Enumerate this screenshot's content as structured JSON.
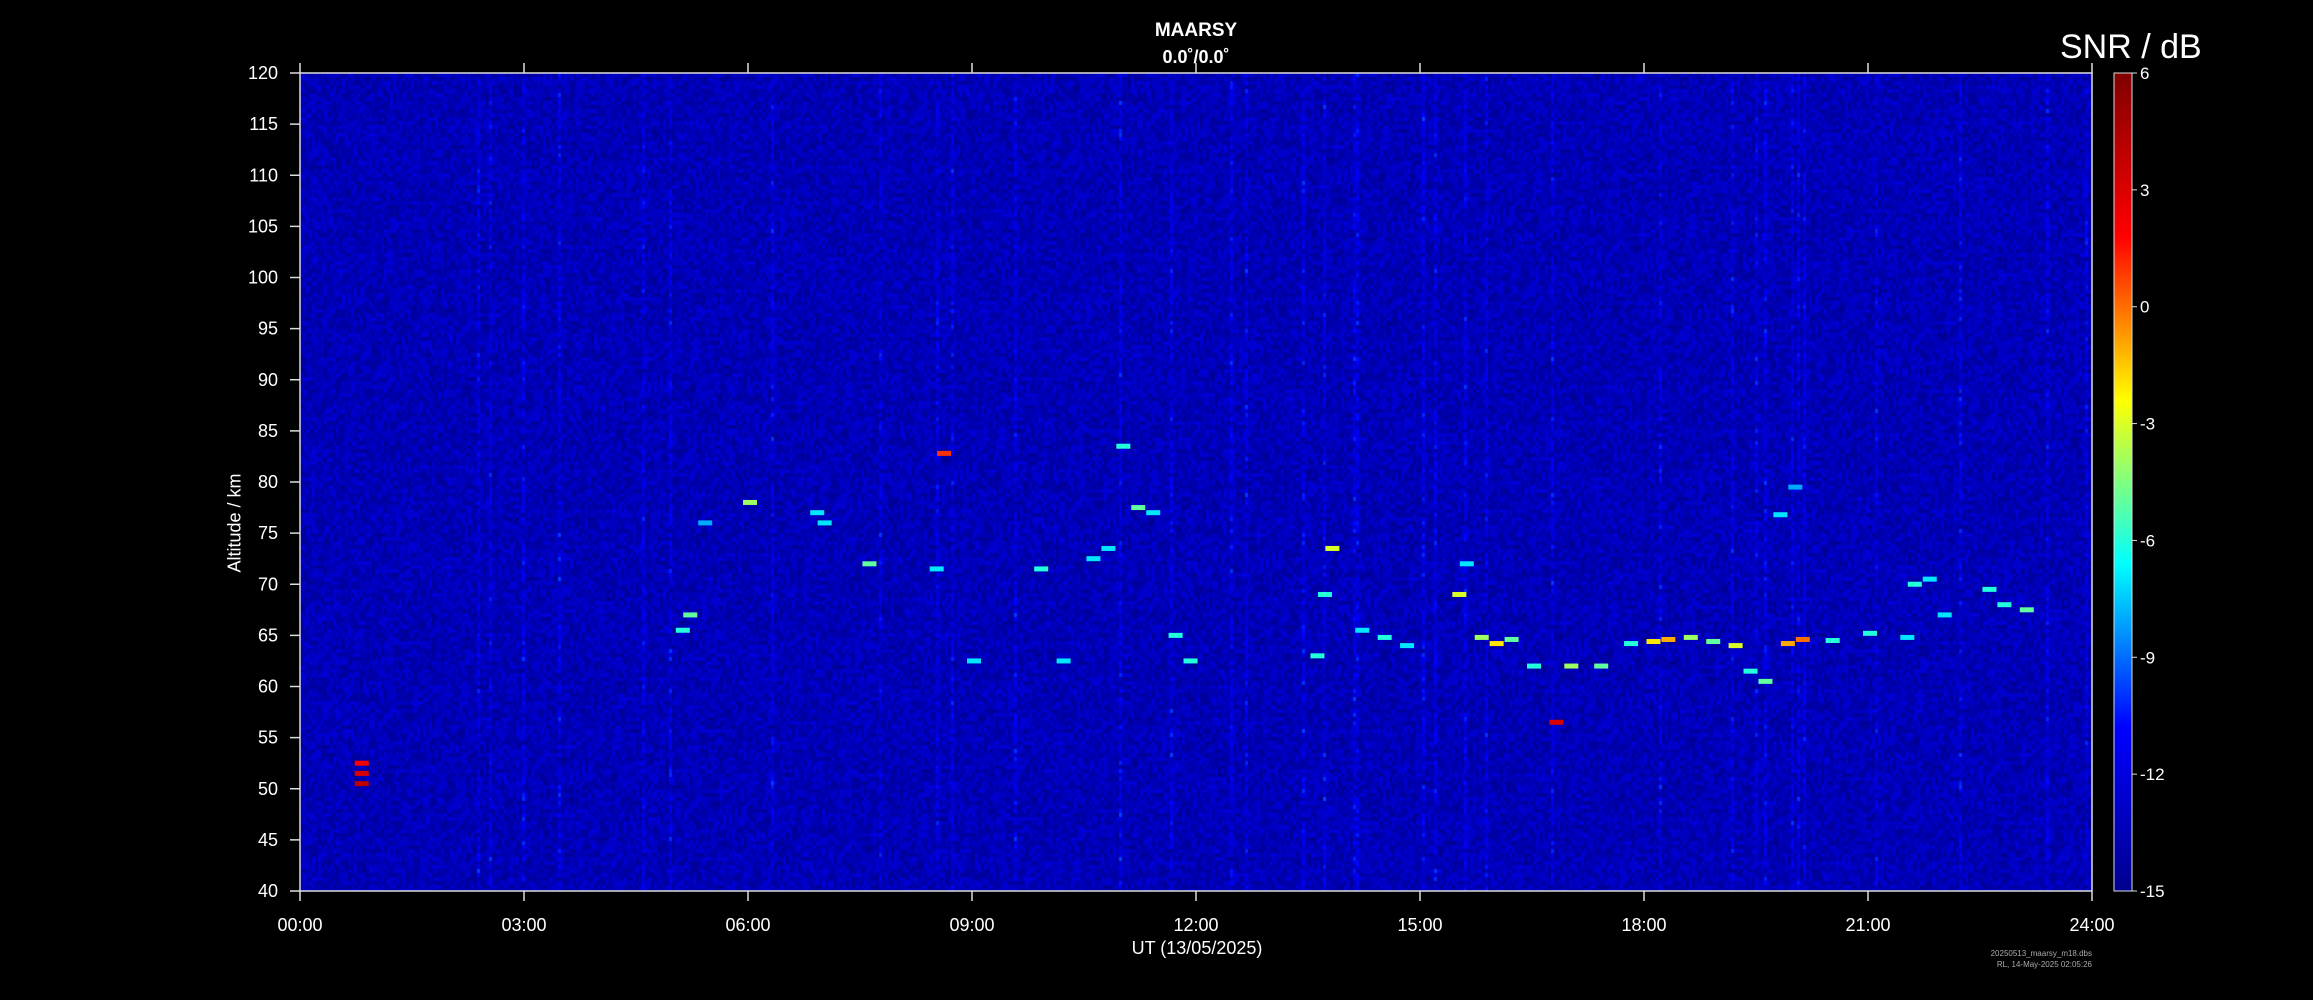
{
  "chart_data": {
    "type": "heatmap",
    "title": "MAARSY",
    "subtitle": "0.0˚/0.0˚",
    "xlabel": "UT (13/05/2025)",
    "ylabel": "Altitude / km",
    "colorbar_label": "SNR / dB",
    "x_ticks": [
      "00:00",
      "03:00",
      "06:00",
      "09:00",
      "12:00",
      "15:00",
      "18:00",
      "21:00",
      "24:00"
    ],
    "xlim_hours": [
      0,
      24
    ],
    "ylim": [
      40,
      120
    ],
    "y_ticks": [
      40,
      45,
      50,
      55,
      60,
      65,
      70,
      75,
      80,
      85,
      90,
      95,
      100,
      105,
      110,
      115,
      120
    ],
    "clim": [
      -15,
      6
    ],
    "colorbar_ticks": [
      6,
      3,
      0,
      -3,
      -6,
      -9,
      -12,
      -15
    ],
    "colormap": [
      "#00008f",
      "#0000ff",
      "#00ffff",
      "#ffff00",
      "#ff0000",
      "#800000"
    ],
    "background_value_db": -13.5,
    "echoes": [
      {
        "t_hours": 0.8,
        "alt_km": 50.5,
        "snr_db": 4
      },
      {
        "t_hours": 0.8,
        "alt_km": 51.5,
        "snr_db": 3
      },
      {
        "t_hours": 0.8,
        "alt_km": 52.5,
        "snr_db": 2
      },
      {
        "t_hours": 5.1,
        "alt_km": 65.5,
        "snr_db": -6
      },
      {
        "t_hours": 5.2,
        "alt_km": 67,
        "snr_db": -5
      },
      {
        "t_hours": 5.4,
        "alt_km": 76,
        "snr_db": -8
      },
      {
        "t_hours": 6.0,
        "alt_km": 78,
        "snr_db": -4
      },
      {
        "t_hours": 6.9,
        "alt_km": 77,
        "snr_db": -7
      },
      {
        "t_hours": 7.0,
        "alt_km": 76,
        "snr_db": -7
      },
      {
        "t_hours": 7.6,
        "alt_km": 72,
        "snr_db": -5
      },
      {
        "t_hours": 8.6,
        "alt_km": 82.8,
        "snr_db": 1
      },
      {
        "t_hours": 8.5,
        "alt_km": 71.5,
        "snr_db": -7
      },
      {
        "t_hours": 9.0,
        "alt_km": 62.5,
        "snr_db": -7
      },
      {
        "t_hours": 9.9,
        "alt_km": 71.5,
        "snr_db": -6
      },
      {
        "t_hours": 10.2,
        "alt_km": 62.5,
        "snr_db": -7
      },
      {
        "t_hours": 10.6,
        "alt_km": 72.5,
        "snr_db": -7
      },
      {
        "t_hours": 10.8,
        "alt_km": 73.5,
        "snr_db": -7
      },
      {
        "t_hours": 11.0,
        "alt_km": 83.5,
        "snr_db": -6
      },
      {
        "t_hours": 11.2,
        "alt_km": 77.5,
        "snr_db": -5
      },
      {
        "t_hours": 11.4,
        "alt_km": 77,
        "snr_db": -7
      },
      {
        "t_hours": 11.7,
        "alt_km": 65,
        "snr_db": -6
      },
      {
        "t_hours": 11.9,
        "alt_km": 62.5,
        "snr_db": -6
      },
      {
        "t_hours": 13.6,
        "alt_km": 63,
        "snr_db": -6
      },
      {
        "t_hours": 13.7,
        "alt_km": 69,
        "snr_db": -6
      },
      {
        "t_hours": 13.8,
        "alt_km": 73.5,
        "snr_db": -3
      },
      {
        "t_hours": 14.2,
        "alt_km": 65.5,
        "snr_db": -7
      },
      {
        "t_hours": 14.5,
        "alt_km": 64.8,
        "snr_db": -6
      },
      {
        "t_hours": 14.8,
        "alt_km": 64,
        "snr_db": -7
      },
      {
        "t_hours": 15.5,
        "alt_km": 69,
        "snr_db": -3
      },
      {
        "t_hours": 15.6,
        "alt_km": 72,
        "snr_db": -7
      },
      {
        "t_hours": 15.8,
        "alt_km": 64.8,
        "snr_db": -4
      },
      {
        "t_hours": 16.0,
        "alt_km": 64.2,
        "snr_db": -2
      },
      {
        "t_hours": 16.2,
        "alt_km": 64.6,
        "snr_db": -5
      },
      {
        "t_hours": 16.5,
        "alt_km": 62,
        "snr_db": -6
      },
      {
        "t_hours": 16.8,
        "alt_km": 56.5,
        "snr_db": 3
      },
      {
        "t_hours": 17.0,
        "alt_km": 62,
        "snr_db": -4
      },
      {
        "t_hours": 17.4,
        "alt_km": 62,
        "snr_db": -5
      },
      {
        "t_hours": 17.8,
        "alt_km": 64.2,
        "snr_db": -6
      },
      {
        "t_hours": 18.1,
        "alt_km": 64.4,
        "snr_db": -2
      },
      {
        "t_hours": 18.3,
        "alt_km": 64.6,
        "snr_db": -1
      },
      {
        "t_hours": 18.6,
        "alt_km": 64.8,
        "snr_db": -4
      },
      {
        "t_hours": 18.9,
        "alt_km": 64.4,
        "snr_db": -5
      },
      {
        "t_hours": 19.2,
        "alt_km": 64,
        "snr_db": -3
      },
      {
        "t_hours": 19.4,
        "alt_km": 61.5,
        "snr_db": -6
      },
      {
        "t_hours": 19.6,
        "alt_km": 60.5,
        "snr_db": -5
      },
      {
        "t_hours": 19.9,
        "alt_km": 64.2,
        "snr_db": -1
      },
      {
        "t_hours": 20.1,
        "alt_km": 64.6,
        "snr_db": 0
      },
      {
        "t_hours": 19.8,
        "alt_km": 76.8,
        "snr_db": -7
      },
      {
        "t_hours": 20.0,
        "alt_km": 79.5,
        "snr_db": -8
      },
      {
        "t_hours": 20.5,
        "alt_km": 64.5,
        "snr_db": -6
      },
      {
        "t_hours": 21.0,
        "alt_km": 65.2,
        "snr_db": -6
      },
      {
        "t_hours": 21.5,
        "alt_km": 64.8,
        "snr_db": -7
      },
      {
        "t_hours": 21.6,
        "alt_km": 70,
        "snr_db": -6
      },
      {
        "t_hours": 21.8,
        "alt_km": 70.5,
        "snr_db": -7
      },
      {
        "t_hours": 22.0,
        "alt_km": 67,
        "snr_db": -7
      },
      {
        "t_hours": 22.6,
        "alt_km": 69.5,
        "snr_db": -6
      },
      {
        "t_hours": 22.8,
        "alt_km": 68,
        "snr_db": -6
      },
      {
        "t_hours": 23.1,
        "alt_km": 67.5,
        "snr_db": -5
      }
    ]
  },
  "footer": {
    "line1": "20250513_maarsy_m18.dbs",
    "line2": "RL, 14-May-2025 02:05:26"
  }
}
